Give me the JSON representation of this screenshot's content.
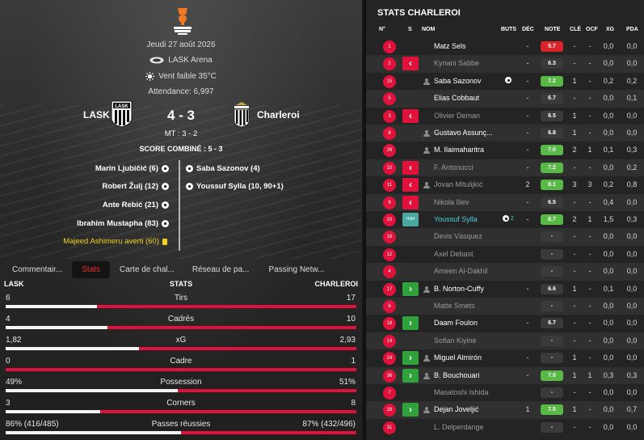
{
  "match": {
    "competition_logo_text": "EUROPA LEAGUE",
    "date": "Jeudi 27 août 2026",
    "stadium": "LASK Arena",
    "weather": "Vent faible 35°C",
    "attendance": "Attendance: 6,997",
    "home": "LASK",
    "away": "Charleroi",
    "score": "4 - 3",
    "halftime": "MT : 3 - 2",
    "aggregate": "SCORE COMBINÉ : 5 - 3",
    "home_scorers": [
      "Marin Ljubičić (6)",
      "Robert Žulj (12)",
      "Ante Rebić (21)",
      "Ibrahim Mustapha (83)"
    ],
    "away_scorers": [
      "Saba Sazonov (4)",
      "Youssuf Sylla (10, 90+1)"
    ],
    "booking": "Majeed Ashimeru averti (60)",
    "colors": {
      "accent": "#e0113a",
      "yellow": "#f2d21b",
      "green": "#2fa23c"
    }
  },
  "tabs": [
    "Commentair...",
    "Stats",
    "Carte de chal...",
    "Réseau de pa...",
    "Passing Netw..."
  ],
  "stats": {
    "home_label": "LASK",
    "title": "STATS",
    "away_label": "CHARLEROI",
    "rows": [
      {
        "name": "Tirs",
        "home": "6",
        "away": "17",
        "home_share": 0.26
      },
      {
        "name": "Cadrés",
        "home": "4",
        "away": "10",
        "home_share": 0.29
      },
      {
        "name": "xG",
        "home": "1,82",
        "away": "2,93",
        "home_share": 0.38
      },
      {
        "name": "Cadre",
        "home": "0",
        "away": "1",
        "home_share": 0.0
      },
      {
        "name": "Possession",
        "home": "49%",
        "away": "51%",
        "home_share": 0.49
      },
      {
        "name": "Corners",
        "home": "3",
        "away": "8",
        "home_share": 0.27
      },
      {
        "name": "Passes réussies",
        "home": "86% (416/485)",
        "away": "87% (432/496)",
        "home_share": 0.5
      }
    ]
  },
  "player_stats": {
    "title": "STATS CHARLEROI",
    "columns": {
      "num": "N°",
      "sub": "S",
      "name": "NOM",
      "goals": "BUTS",
      "dec": "DÉC",
      "rating": "NOTE",
      "key": "CLÉ",
      "ocf": "OCF",
      "xg": "XG",
      "pda": "PDA"
    },
    "players": [
      {
        "num": "1",
        "sub": "",
        "name": "Matz Sels",
        "icon": false,
        "dim": false,
        "goals": "",
        "dec": "-",
        "rating": "5.7",
        "rating_color": "#d8242a",
        "key": "-",
        "ocf": "-",
        "xg": "0,0",
        "pda": "0,0"
      },
      {
        "num": "2",
        "sub": "out",
        "name": "Kyriani Sabbe",
        "icon": false,
        "dim": true,
        "goals": "",
        "dec": "-",
        "rating": "6.3",
        "rating_color": "#3a3a3a",
        "key": "-",
        "ocf": "-",
        "xg": "0,0",
        "pda": "0,0"
      },
      {
        "num": "15",
        "sub": "",
        "name": "Saba Sazonov",
        "icon": true,
        "dim": false,
        "goals": "ball",
        "dec": "-",
        "rating": "7.2",
        "rating_color": "#58b947",
        "key": "1",
        "ocf": "-",
        "xg": "0,2",
        "pda": "0,2"
      },
      {
        "num": "5",
        "sub": "",
        "name": "Elias Cobbaut",
        "icon": false,
        "dim": false,
        "goals": "",
        "dec": "-",
        "rating": "6.7",
        "rating_color": "#3a3a3a",
        "key": "-",
        "ocf": "-",
        "xg": "0,0",
        "pda": "0,1"
      },
      {
        "num": "3",
        "sub": "out",
        "name": "Olivier Deman",
        "icon": false,
        "dim": true,
        "goals": "",
        "dec": "-",
        "rating": "6.5",
        "rating_color": "#3a3a3a",
        "key": "1",
        "ocf": "-",
        "xg": "0,0",
        "pda": "0,0"
      },
      {
        "num": "8",
        "sub": "",
        "name": "Gustavo Assunç...",
        "icon": true,
        "dim": false,
        "goals": "",
        "dec": "-",
        "rating": "6.8",
        "rating_color": "#3a3a3a",
        "key": "1",
        "ocf": "-",
        "xg": "0,0",
        "pda": "0,0"
      },
      {
        "num": "26",
        "sub": "",
        "name": "M. Ilaimaharitra",
        "icon": true,
        "dim": false,
        "goals": "",
        "dec": "-",
        "rating": "7.0",
        "rating_color": "#58b947",
        "key": "2",
        "ocf": "1",
        "xg": "0,1",
        "pda": "0,3"
      },
      {
        "num": "10",
        "sub": "out",
        "name": "F. Antonucci",
        "icon": false,
        "dim": true,
        "goals": "",
        "dec": "-",
        "rating": "7.2",
        "rating_color": "#58b947",
        "key": "-",
        "ocf": "-",
        "xg": "0,0",
        "pda": "0,2"
      },
      {
        "num": "11",
        "sub": "out",
        "name": "Jovan Mitulijkić",
        "icon": true,
        "dim": true,
        "goals": "",
        "dec": "2",
        "rating": "8.1",
        "rating_color": "#58b947",
        "key": "3",
        "ocf": "3",
        "xg": "0,2",
        "pda": "0,8"
      },
      {
        "num": "9",
        "sub": "out",
        "name": "Nikola Iliev",
        "icon": false,
        "dim": true,
        "goals": "",
        "dec": "-",
        "rating": "6.5",
        "rating_color": "#3a3a3a",
        "key": "-",
        "ocf": "-",
        "xg": "0,4",
        "pda": "0,0"
      },
      {
        "num": "20",
        "sub": "hdm",
        "name": "Youssuf Sylla",
        "icon": false,
        "dim": false,
        "cyan": true,
        "goals": "ball2",
        "dec": "-",
        "rating": "8.7",
        "rating_color": "#58b947",
        "key": "2",
        "ocf": "1",
        "xg": "1,5",
        "pda": "0,3"
      },
      {
        "num": "16",
        "sub": "",
        "name": "Devis Vásquez",
        "icon": false,
        "dim": true,
        "goals": "",
        "dec": "",
        "rating": "-",
        "rating_color": "#3a3a3a",
        "key": "-",
        "ocf": "-",
        "xg": "0,0",
        "pda": "0,0"
      },
      {
        "num": "12",
        "sub": "",
        "name": "Axel Debast",
        "icon": false,
        "dim": true,
        "goals": "",
        "dec": "",
        "rating": "-",
        "rating_color": "#3a3a3a",
        "key": "-",
        "ocf": "-",
        "xg": "0,0",
        "pda": "0,0"
      },
      {
        "num": "4",
        "sub": "",
        "name": "Ameen Al-Dakhil",
        "icon": false,
        "dim": true,
        "goals": "",
        "dec": "",
        "rating": "-",
        "rating_color": "#3a3a3a",
        "key": "-",
        "ocf": "-",
        "xg": "0,0",
        "pda": "0,0"
      },
      {
        "num": "17",
        "sub": "in",
        "name": "B. Norton-Cuffy",
        "icon": true,
        "dim": false,
        "goals": "",
        "dec": "-",
        "rating": "6.6",
        "rating_color": "#3a3a3a",
        "key": "1",
        "ocf": "-",
        "xg": "0,1",
        "pda": "0,0"
      },
      {
        "num": "6",
        "sub": "",
        "name": "Matte Smets",
        "icon": false,
        "dim": true,
        "goals": "",
        "dec": "",
        "rating": "-",
        "rating_color": "#3a3a3a",
        "key": "-",
        "ocf": "-",
        "xg": "0,0",
        "pda": "0,0"
      },
      {
        "num": "18",
        "sub": "in",
        "name": "Daam Foulon",
        "icon": false,
        "dim": false,
        "goals": "",
        "dec": "-",
        "rating": "6.7",
        "rating_color": "#3a3a3a",
        "key": "-",
        "ocf": "-",
        "xg": "0,0",
        "pda": "0,0"
      },
      {
        "num": "14",
        "sub": "",
        "name": "Sofian Kiyine",
        "icon": false,
        "dim": true,
        "goals": "",
        "dec": "",
        "rating": "-",
        "rating_color": "#3a3a3a",
        "key": "-",
        "ocf": "-",
        "xg": "0,0",
        "pda": "0,0"
      },
      {
        "num": "24",
        "sub": "in",
        "name": "Miguel Almirón",
        "icon": true,
        "dim": false,
        "goals": "",
        "dec": "-",
        "rating": "-",
        "rating_color": "#3a3a3a",
        "key": "1",
        "ocf": "-",
        "xg": "0,0",
        "pda": "0,0"
      },
      {
        "num": "36",
        "sub": "in",
        "name": "B. Bouchouari",
        "icon": true,
        "dim": false,
        "goals": "",
        "dec": "-",
        "rating": "7.0",
        "rating_color": "#58b947",
        "key": "1",
        "ocf": "1",
        "xg": "0,3",
        "pda": "0,3"
      },
      {
        "num": "7",
        "sub": "",
        "name": "Masatoshi Ishida",
        "icon": false,
        "dim": true,
        "goals": "",
        "dec": "",
        "rating": "-",
        "rating_color": "#3a3a3a",
        "key": "-",
        "ocf": "-",
        "xg": "0,0",
        "pda": "0,0"
      },
      {
        "num": "28",
        "sub": "in",
        "name": "Dejan Joveljić",
        "icon": true,
        "dim": false,
        "goals": "",
        "dec": "1",
        "rating": "7.5",
        "rating_color": "#58b947",
        "key": "1",
        "ocf": "-",
        "xg": "0,0",
        "pda": "0,7"
      },
      {
        "num": "31",
        "sub": "",
        "name": "L. Delperdange",
        "icon": false,
        "dim": true,
        "goals": "",
        "dec": "",
        "rating": "-",
        "rating_color": "#3a3a3a",
        "key": "-",
        "ocf": "-",
        "xg": "0,0",
        "pda": "0,0"
      }
    ],
    "hdm_label": "HdM",
    "sylla_goals": "2"
  }
}
